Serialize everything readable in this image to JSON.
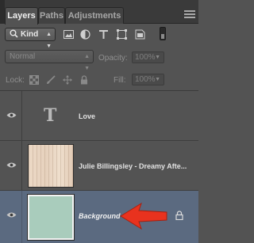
{
  "tabs": [
    {
      "label": "Layers",
      "active": true
    },
    {
      "label": "Paths",
      "active": false
    },
    {
      "label": "Adjustments",
      "active": false
    }
  ],
  "filter": {
    "kind_label": "Kind",
    "icons": [
      "pixel-filter-icon",
      "adjustment-filter-icon",
      "type-filter-icon",
      "shape-filter-icon",
      "smart-object-filter-icon"
    ]
  },
  "blend": {
    "mode": "Normal",
    "opacity_label": "Opacity:",
    "opacity_value": "100%"
  },
  "lock": {
    "label": "Lock:",
    "fill_label": "Fill:",
    "fill_value": "100%"
  },
  "layers": [
    {
      "name": "Love",
      "type": "text",
      "visible": true
    },
    {
      "name": "Julie Billingsley - Dreamy Afte...",
      "type": "image",
      "visible": true
    },
    {
      "name": "Background",
      "type": "background",
      "visible": true,
      "selected": true,
      "locked": true
    }
  ],
  "colors": {
    "panel": "#535353",
    "selected_row": "#5b6a80",
    "annotation_arrow": "#e8321e"
  }
}
